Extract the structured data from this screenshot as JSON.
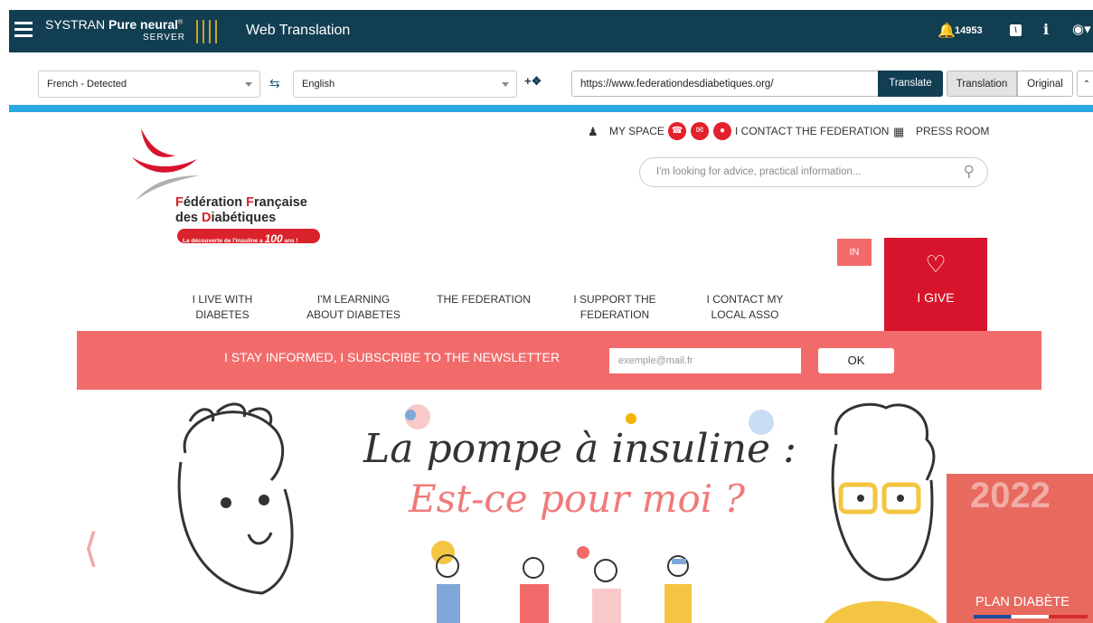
{
  "app": {
    "brand_systran": "SYSTRAN",
    "brand_pure": "Pure neural",
    "brand_reg": "®",
    "brand_server": "SERVER",
    "title": "Web Translation",
    "notification_count": "14953"
  },
  "toolbar": {
    "source_language": "French - Detected",
    "target_language": "English",
    "url_value": "https://www.federationdesdiabetiques.org/",
    "translate_label": "Translate",
    "translation_label": "Translation",
    "original_label": "Original"
  },
  "site": {
    "logo_line1_a": "F",
    "logo_line1_b": "édération ",
    "logo_line1_c": "F",
    "logo_line1_d": "rançaise",
    "logo_line2_a": "des ",
    "logo_line2_b": "D",
    "logo_line2_c": "iabétiques",
    "logo_ribbon": "La découverte de l'insuline a",
    "logo_ribbon_num": "100",
    "logo_ribbon_ans": "ans !",
    "my_space": "MY SPACE",
    "contact_federation": "I CONTACT THE FEDERATION",
    "press_room": "PRESS ROOM",
    "search_placeholder": "I'm looking for advice, practical information...",
    "in_label": "IN",
    "give_label": "I GIVE",
    "nav": [
      {
        "line1": "I LIVE WITH",
        "line2": "DIABETES"
      },
      {
        "line1": "I'M LEARNING",
        "line2": "ABOUT DIABETES"
      },
      {
        "line1": "THE FEDERATION",
        "line2": ""
      },
      {
        "line1": "I SUPPORT THE",
        "line2": "FEDERATION"
      },
      {
        "line1": "I CONTACT MY",
        "line2": "LOCAL ASSO"
      }
    ],
    "newsletter_text": "I STAY INFORMED, I SUBSCRIBE TO THE NEWSLETTER",
    "newsletter_placeholder": "exemple@mail.fr",
    "newsletter_ok": "OK",
    "hero_line1": "La pompe à insuline :",
    "hero_line2": "Est-ce pour moi ?",
    "plan_year": "2022",
    "plan_label": "PLAN DIABÈTE"
  },
  "colors": {
    "header_bg": "#123e52",
    "accent_blue": "#29a8e0",
    "coral": "#f26b6b",
    "give_red": "#d7142b"
  },
  "icons": [
    "menu-icon",
    "bell-icon",
    "rss-icon",
    "info-icon",
    "globe-icon",
    "swap-icon",
    "plus-info-icon",
    "collapse-icon",
    "person-icon",
    "phone-icon",
    "mail-icon",
    "location-icon",
    "press-icon",
    "search-icon",
    "heart-icon",
    "chevron-left-icon"
  ]
}
